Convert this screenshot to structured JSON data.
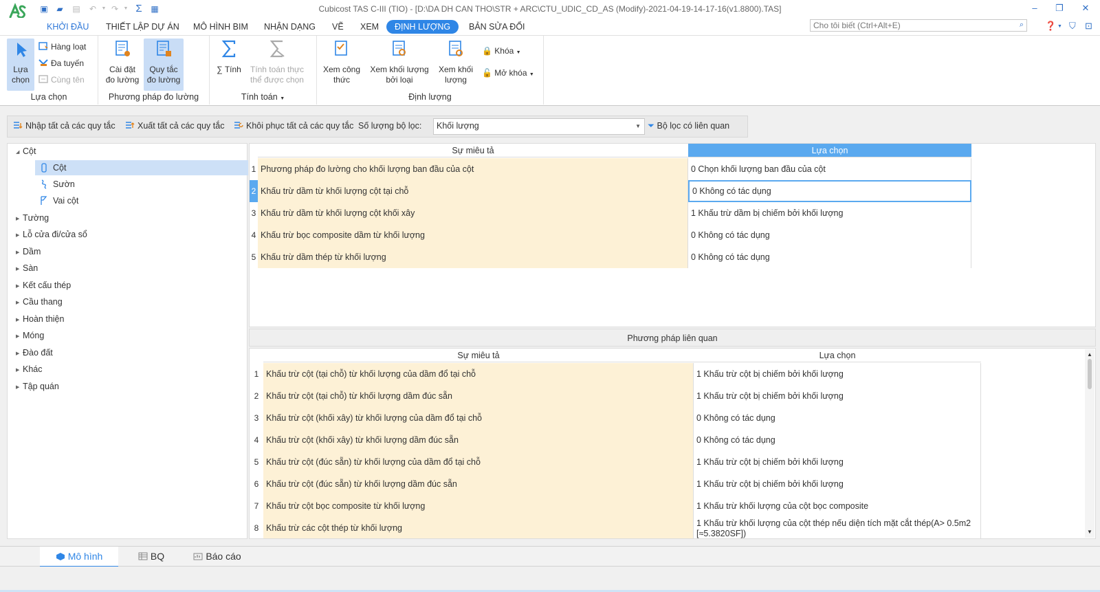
{
  "window": {
    "title": "Cubicost TAS C-III (TIO) - [D:\\DA DH CAN THO\\STR + ARC\\CTU_UDIC_CD_AS (Modify)-2021-04-19-14-17-16(v1.8800).TAS]",
    "minimize": "–",
    "restore": "❐",
    "close": "✕"
  },
  "menu_tabs": [
    "KHỞI ĐẦU",
    "THIẾT LẬP DỰ ÁN",
    "MÔ HÌNH BIM",
    "NHẬN DẠNG",
    "VẼ",
    "XEM",
    "ĐỊNH LƯỢNG",
    "BẢN SỬA ĐỔI"
  ],
  "active_menu_tab": "ĐỊNH LƯỢNG",
  "tellme_placeholder": "Cho tôi biết (Ctrl+Alt+E)",
  "ribbon": {
    "select_group": {
      "label": "Lựa chọn",
      "select_btn_l1": "Lựa",
      "select_btn_l2": "chọn",
      "batch": "Hàng loạt",
      "multi_axis": "Đa tuyến",
      "same_name": "Cùng tên"
    },
    "method_group": {
      "label": "Phương pháp đo lường",
      "setup_l1": "Cài đặt",
      "setup_l2": "đo lường",
      "rules_l1": "Quy tắc",
      "rules_l2": "đo lường"
    },
    "calc_group": {
      "label": "Tính toán",
      "calc": "∑ Tính",
      "calc_sel_l1": "Tính toán thực",
      "calc_sel_l2": "thể được chọn"
    },
    "qty_group": {
      "label": "Định lượng",
      "formula_l1": "Xem công",
      "formula_l2": "thức",
      "qty_type_l1": "Xem khối lượng",
      "qty_type_l2": "bởi loại",
      "qty_l1": "Xem khối",
      "qty_l2": "lượng",
      "lock": "Khóa",
      "unlock": "Mở khóa"
    }
  },
  "rule_toolbar": {
    "import_all": "Nhập tất cả các quy tắc",
    "export_all": "Xuất tất cả các quy tắc",
    "restore_all": "Khôi phục tất cả các quy tắc",
    "filter_label": "Số lượng bộ lọc:",
    "filter_value": "Khối lượng",
    "related_filter": "Bộ lọc có liên quan"
  },
  "tree": {
    "root": "Cột",
    "children": [
      "Cột",
      "Sườn",
      "Vai cột"
    ],
    "others": [
      "Tường",
      "Lỗ cửa đi/cửa sổ",
      "Dầm",
      "Sàn",
      "Kết cấu thép",
      "Cầu thang",
      "Hoàn thiện",
      "Móng",
      "Đào đất",
      "Khác",
      "Tập quán"
    ]
  },
  "main_table": {
    "col_desc": "Sự miêu tả",
    "col_choice": "Lựa chọn",
    "rows": [
      {
        "num": "1",
        "desc": "Phương pháp đo lường cho khối lượng ban đầu của cột",
        "choice": "0 Chọn khối lượng ban đầu của cột"
      },
      {
        "num": "2",
        "desc": "Khấu trừ dầm từ khối lượng cột tại chỗ",
        "choice": "0 Không có tác dụng"
      },
      {
        "num": "3",
        "desc": "Khấu trừ dầm từ khối lượng cột khối xây",
        "choice": "1 Khấu trừ dầm bị chiếm bởi khối lượng"
      },
      {
        "num": "4",
        "desc": "Khấu trừ bọc composite dầm từ khối lượng",
        "choice": "0 Không có tác dụng"
      },
      {
        "num": "5",
        "desc": "Khấu trừ dầm thép từ khối lượng",
        "choice": "0 Không có tác dụng"
      }
    ]
  },
  "related": {
    "title": "Phương pháp liên quan",
    "col_desc": "Sự miêu tả",
    "col_choice": "Lựa chọn",
    "rows": [
      {
        "num": "1",
        "desc": "Khấu trừ cột (tại chỗ) từ khối lượng của dầm đổ tại chỗ",
        "choice": "1 Khấu trừ cột bị chiếm bởi khối lượng"
      },
      {
        "num": "2",
        "desc": "Khấu trừ cột (tại chỗ) từ khối lượng dầm đúc sẵn",
        "choice": "1 Khấu trừ cột bị chiếm bởi khối lượng"
      },
      {
        "num": "3",
        "desc": "Khấu trừ cột (khối xây) từ khối lượng của dầm đổ tại chỗ",
        "choice": "0 Không có tác dụng"
      },
      {
        "num": "4",
        "desc": "Khấu trừ cột (khối xây) từ khối lượng dầm đúc sẵn",
        "choice": "0 Không có tác dụng"
      },
      {
        "num": "5",
        "desc": "Khấu trừ cột (đúc sẵn) từ khối lượng của dầm đổ tại chỗ",
        "choice": "1 Khấu trừ cột bị chiếm bởi khối lượng"
      },
      {
        "num": "6",
        "desc": "Khấu trừ cột (đúc sẵn) từ khối lượng dầm đúc sẵn",
        "choice": "1 Khấu trừ cột bị chiếm bởi khối lượng"
      },
      {
        "num": "7",
        "desc": "Khấu trừ cột bọc composite từ khối lượng",
        "choice": "1 Khấu trừ khối lượng của cột bọc composite"
      },
      {
        "num": "8",
        "desc": "Khấu trừ các cột thép từ khối lượng",
        "choice": "1 Khấu trừ khối lượng của cột thép nếu diện tích mặt cắt thép(A> 0.5m2 [≈5.3820SF])"
      }
    ]
  },
  "bottom_tabs": [
    "Mô hình",
    "BQ",
    "Báo cáo"
  ],
  "colors": {
    "accent": "#2f86e6",
    "selected_header": "#5aa9ef",
    "desc_cell": "#fdf1d6",
    "logo": "#3aa65a"
  }
}
